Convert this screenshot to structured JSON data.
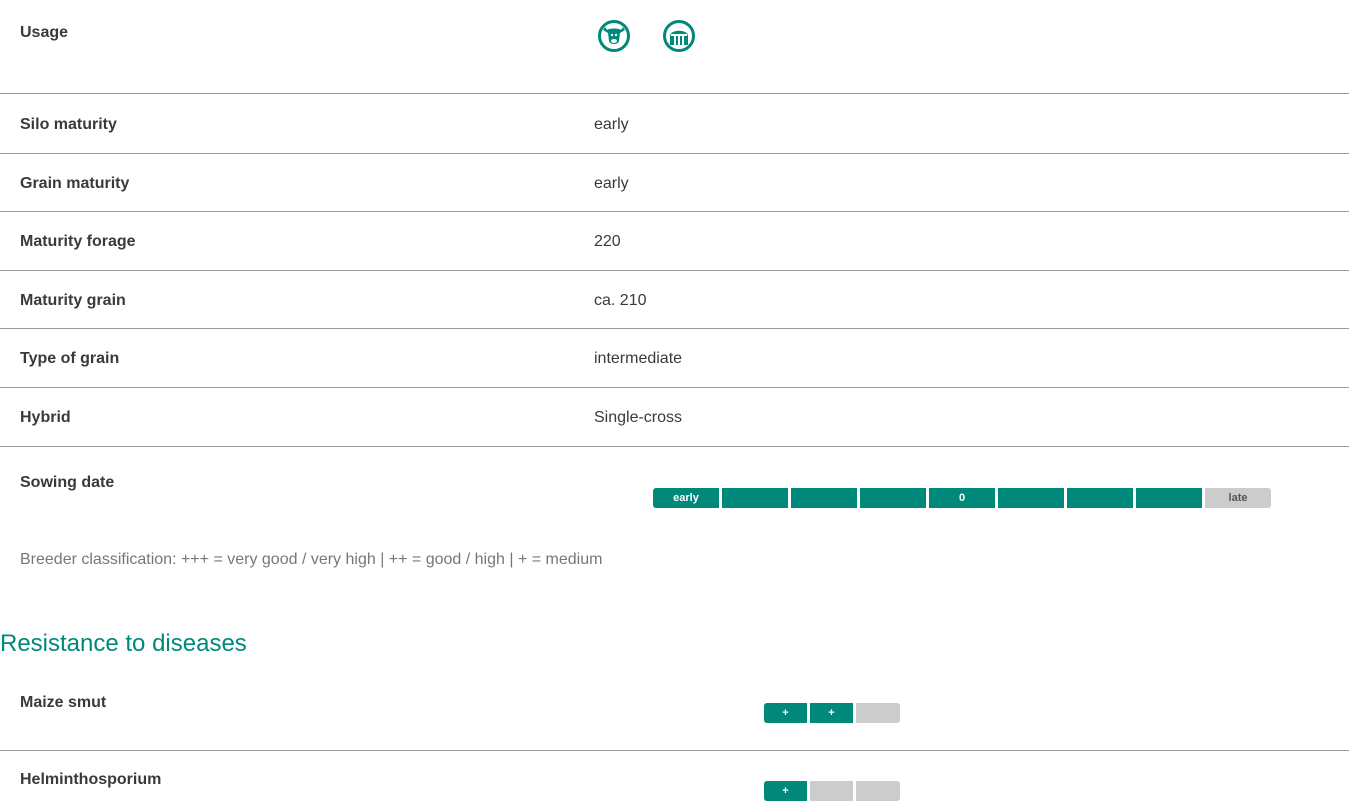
{
  "usage": {
    "label": "Usage",
    "icons": [
      "cow-icon",
      "barn-icon"
    ]
  },
  "rows": [
    {
      "label": "Silo maturity",
      "value": "early"
    },
    {
      "label": "Grain maturity",
      "value": "early"
    },
    {
      "label": "Maturity forage",
      "value": "220"
    },
    {
      "label": "Maturity grain",
      "value": "ca. 210"
    },
    {
      "label": "Type of grain",
      "value": "intermediate"
    },
    {
      "label": "Hybrid",
      "value": "Single-cross"
    }
  ],
  "sowing": {
    "label": "Sowing date",
    "segments": [
      "early",
      "",
      "",
      "",
      "0",
      "",
      "",
      "",
      "late"
    ]
  },
  "note": "Breeder classification: +++ = very good / very high | ++ = good / high | + = medium",
  "diseases": {
    "title": "Resistance to diseases",
    "items": [
      {
        "label": "Maize smut",
        "rating": "++",
        "filled": 2,
        "total": 3
      },
      {
        "label": "Helminthosporium",
        "rating": "+",
        "filled": 1,
        "total": 3
      }
    ]
  },
  "colors": {
    "accent": "#00897b",
    "inactive": "#cccccc"
  }
}
